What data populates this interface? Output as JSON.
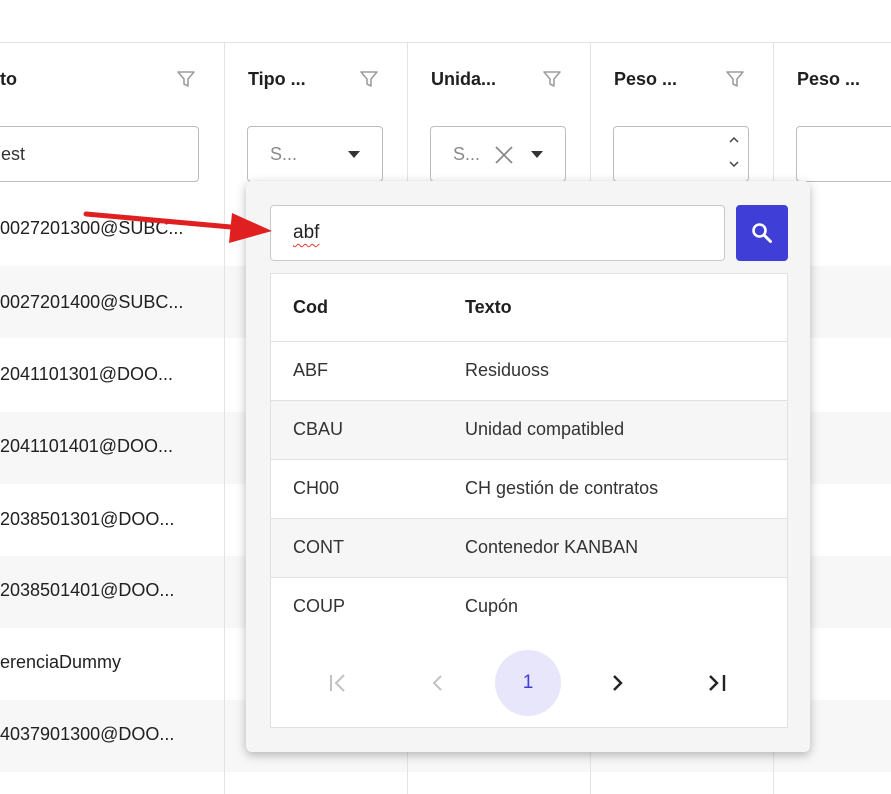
{
  "grid": {
    "columns": [
      {
        "label": "to",
        "filter_value": "est",
        "filter_type": "text"
      },
      {
        "label": "Tipo ...",
        "filter_value": "S...",
        "filter_type": "select"
      },
      {
        "label": "Unida...",
        "filter_value": "S...",
        "filter_type": "select-clearable"
      },
      {
        "label": "Peso ...",
        "filter_value": "",
        "filter_type": "number"
      },
      {
        "label": "Peso ...",
        "filter_value": "",
        "filter_type": "text"
      }
    ],
    "rows": [
      "0027201300@SUBC...",
      "0027201400@SUBC...",
      "2041101301@DOO...",
      "2041101401@DOO...",
      "2038501301@DOO...",
      "2038501401@DOO...",
      "erenciaDummy",
      "4037901300@DOO..."
    ]
  },
  "dropdown": {
    "search_value": "abf",
    "headers": {
      "code": "Cod",
      "text": "Texto"
    },
    "items": [
      {
        "code": "ABF",
        "text": "Residuoss"
      },
      {
        "code": "CBAU",
        "text": "Unidad compatibled"
      },
      {
        "code": "CH00",
        "text": "CH gestión de contratos"
      },
      {
        "code": "CONT",
        "text": "Contenedor KANBAN"
      },
      {
        "code": "COUP",
        "text": "Cupón"
      }
    ],
    "pagination": {
      "current_page": "1",
      "first": "|<",
      "prev": "<",
      "next": ">",
      "last": ">|"
    }
  },
  "colors": {
    "accent": "#3f3fd8",
    "annotation": "#e02020"
  }
}
